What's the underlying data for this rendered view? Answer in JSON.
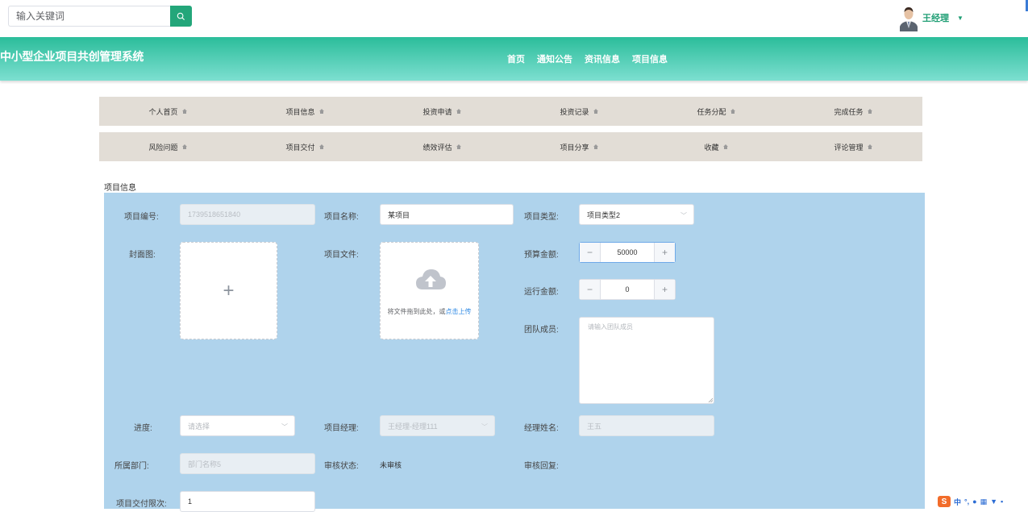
{
  "search": {
    "placeholder": "输入关键词"
  },
  "user": {
    "name": "王经理"
  },
  "header": {
    "brand": "中小型企业项目共创管理系统"
  },
  "top_nav": [
    "首页",
    "通知公告",
    "资讯信息",
    "项目信息"
  ],
  "menu_row1": [
    "个人首页",
    "项目信息",
    "投资申请",
    "投资记录",
    "任务分配",
    "完成任务"
  ],
  "menu_row2": [
    "风险问题",
    "项目交付",
    "绩效评估",
    "项目分享",
    "收藏",
    "评论管理"
  ],
  "section_title": "项目信息",
  "form": {
    "project_no_label": "项目编号:",
    "project_no_value": "1739518651840",
    "project_name_label": "项目名称:",
    "project_name_value": "某项目",
    "project_type_label": "项目类型:",
    "project_type_value": "项目类型2",
    "cover_label": "封面图:",
    "cover_plus": "+",
    "file_label": "项目文件:",
    "file_upload_text": "将文件拖到此处，或",
    "file_upload_link": "点击上传",
    "budget_label": "预算金额:",
    "budget_value": "50000",
    "running_label": "运行金额:",
    "running_value": "0",
    "team_label": "团队成员:",
    "team_placeholder": "请输入团队成员",
    "progress_label": "进度:",
    "progress_placeholder": "请选择",
    "manager_label": "项目经理:",
    "manager_value": "王经理-经理111",
    "manager_name_label": "经理姓名:",
    "manager_name_value": "王五",
    "dept_label": "所属部门:",
    "dept_value": "部门名称5",
    "audit_status_label": "审核状态:",
    "audit_status_value": "未审核",
    "audit_reply_label": "审核回复:",
    "delivery_label": "项目交付限次:",
    "delivery_value": "1"
  },
  "ime": {
    "mode": "中",
    "logo": "S"
  },
  "colors": {
    "accent": "#23a67a",
    "panel": "#afd3ec",
    "menu_bg": "#e2ddd6"
  }
}
